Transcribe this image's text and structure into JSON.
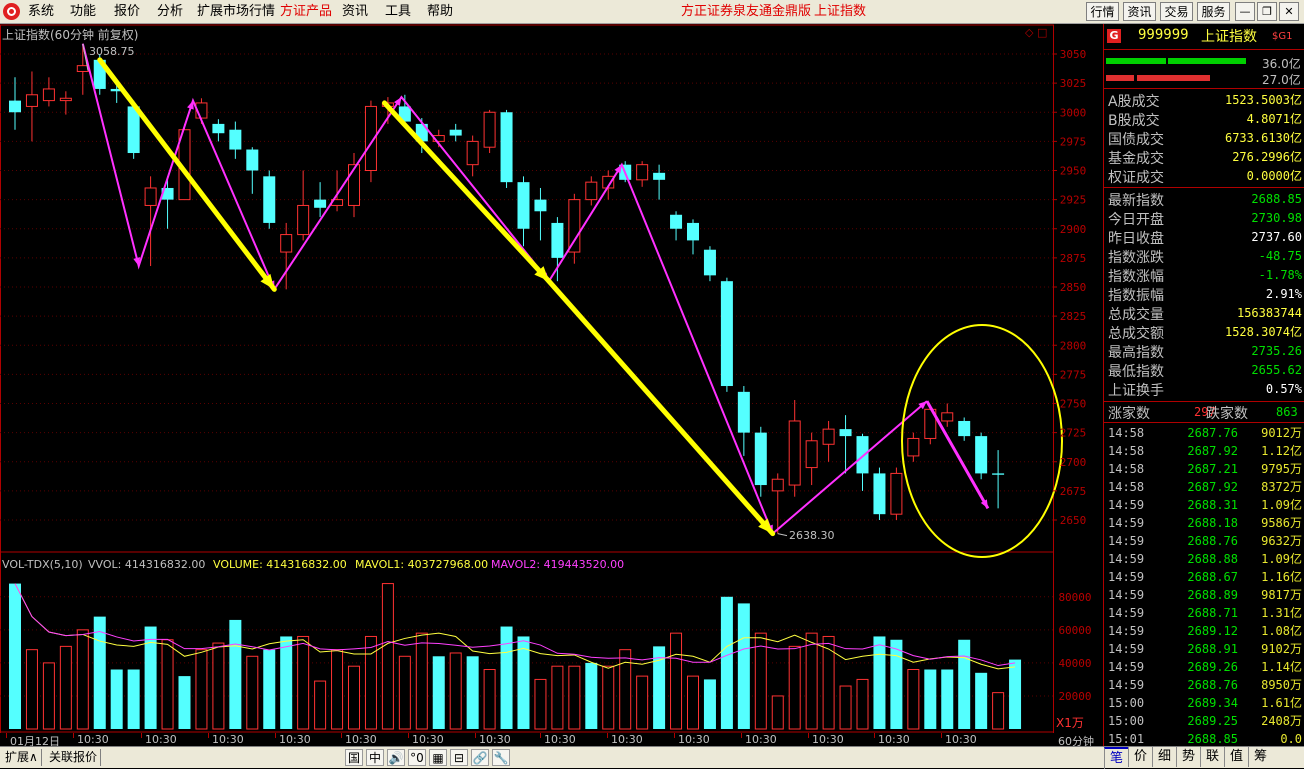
{
  "menubar": {
    "items": [
      "系统",
      "功能",
      "报价",
      "分析",
      "扩展市场行情",
      "方证产品",
      "资讯",
      "工具",
      "帮助"
    ],
    "highlight_item": "方证产品",
    "title": "方正证券泉友通金鼎版",
    "title_index": "上证指数",
    "tab_buttons": [
      "行情",
      "资讯",
      "交易",
      "服务"
    ]
  },
  "chart": {
    "header": "上证指数(60分钟 前复权)",
    "high_marker": "3058.75",
    "low_marker": "2638.30",
    "price_axis": [
      "3050",
      "3025",
      "3000",
      "2975",
      "2950",
      "2925",
      "2900",
      "2875",
      "2850",
      "2825",
      "2800",
      "2775",
      "2750",
      "2725",
      "2700",
      "2675",
      "2650"
    ],
    "vol_header": {
      "name": "VOL-TDX(5,10)",
      "vol": "VVOL: 414316832.00",
      "volume": "VOLUME: 414316832.00",
      "mavol1": "MAVOL1: 403727968.00",
      "mavol2": "MAVOL2: 419443520.00"
    },
    "vol_axis": [
      "80000",
      "60000",
      "40000",
      "20000"
    ],
    "vol_unit": "X1万",
    "time_labels": [
      "01月12日",
      "10:30",
      "10:30",
      "10:30",
      "10:30",
      "10:30",
      "10:30",
      "10:30",
      "10:30",
      "10:30",
      "10:30",
      "10:30",
      "10:30",
      "10:30",
      "10:30",
      "10:30"
    ],
    "period_label": "60分钟",
    "colors": {
      "up": "#ff3232",
      "down": "#54ffff",
      "arrow_big": "#ffff00",
      "arrow_small": "#ff30ff",
      "ma1": "#ffff40",
      "ma2": "#ff40ff",
      "ellipse": "#ffff00"
    }
  },
  "chart_data": {
    "type": "candlestick",
    "title": "上证指数(60分钟 前复权)",
    "period": "60分钟",
    "ylim": [
      2630,
      3070
    ],
    "candles": [
      {
        "o": 3010,
        "c": 3000,
        "h": 3030,
        "l": 2985
      },
      {
        "o": 3005,
        "c": 3015,
        "h": 3035,
        "l": 2975
      },
      {
        "o": 3010,
        "c": 3020,
        "h": 3030,
        "l": 3005
      },
      {
        "o": 3010,
        "c": 3012,
        "h": 3018,
        "l": 2998
      },
      {
        "o": 3035,
        "c": 3040,
        "h": 3058.75,
        "l": 3015
      },
      {
        "o": 3045,
        "c": 3020,
        "h": 3050,
        "l": 3015
      },
      {
        "o": 3020,
        "c": 3018,
        "h": 3025,
        "l": 3008
      },
      {
        "o": 3005,
        "c": 2965,
        "h": 3010,
        "l": 2960
      },
      {
        "o": 2920,
        "c": 2935,
        "h": 2945,
        "l": 2868
      },
      {
        "o": 2935,
        "c": 2925,
        "h": 2945,
        "l": 2900
      },
      {
        "o": 2925,
        "c": 2985,
        "h": 2990,
        "l": 2925
      },
      {
        "o": 2995,
        "c": 3008,
        "h": 3012,
        "l": 2990
      },
      {
        "o": 2990,
        "c": 2982,
        "h": 2994,
        "l": 2975
      },
      {
        "o": 2985,
        "c": 2968,
        "h": 2992,
        "l": 2960
      },
      {
        "o": 2968,
        "c": 2950,
        "h": 2970,
        "l": 2930
      },
      {
        "o": 2945,
        "c": 2905,
        "h": 2950,
        "l": 2900
      },
      {
        "o": 2880,
        "c": 2895,
        "h": 2905,
        "l": 2848
      },
      {
        "o": 2895,
        "c": 2920,
        "h": 2950,
        "l": 2890
      },
      {
        "o": 2925,
        "c": 2918,
        "h": 2940,
        "l": 2910
      },
      {
        "o": 2920,
        "c": 2925,
        "h": 2950,
        "l": 2915
      },
      {
        "o": 2920,
        "c": 2955,
        "h": 2965,
        "l": 2910
      },
      {
        "o": 2950,
        "c": 3005,
        "h": 3010,
        "l": 2940
      },
      {
        "o": 3005,
        "c": 3008,
        "h": 3013,
        "l": 2990
      },
      {
        "o": 3005,
        "c": 2992,
        "h": 3015,
        "l": 2988
      },
      {
        "o": 2990,
        "c": 2975,
        "h": 2995,
        "l": 2965
      },
      {
        "o": 2975,
        "c": 2980,
        "h": 2985,
        "l": 2970
      },
      {
        "o": 2985,
        "c": 2980,
        "h": 2990,
        "l": 2975
      },
      {
        "o": 2955,
        "c": 2975,
        "h": 2980,
        "l": 2945
      },
      {
        "o": 2970,
        "c": 3000,
        "h": 3002,
        "l": 2965
      },
      {
        "o": 3000,
        "c": 2940,
        "h": 3002,
        "l": 2935
      },
      {
        "o": 2940,
        "c": 2900,
        "h": 2945,
        "l": 2885
      },
      {
        "o": 2925,
        "c": 2915,
        "h": 2935,
        "l": 2890
      },
      {
        "o": 2905,
        "c": 2875,
        "h": 2910,
        "l": 2855
      },
      {
        "o": 2880,
        "c": 2925,
        "h": 2930,
        "l": 2870
      },
      {
        "o": 2925,
        "c": 2940,
        "h": 2945,
        "l": 2920
      },
      {
        "o": 2935,
        "c": 2945,
        "h": 2950,
        "l": 2925
      },
      {
        "o": 2955,
        "c": 2942,
        "h": 2958,
        "l": 2940
      },
      {
        "o": 2942,
        "c": 2955,
        "h": 2958,
        "l": 2936
      },
      {
        "o": 2948,
        "c": 2942,
        "h": 2955,
        "l": 2925
      },
      {
        "o": 2912,
        "c": 2900,
        "h": 2915,
        "l": 2890
      },
      {
        "o": 2905,
        "c": 2890,
        "h": 2908,
        "l": 2878
      },
      {
        "o": 2882,
        "c": 2860,
        "h": 2885,
        "l": 2855
      },
      {
        "o": 2855,
        "c": 2765,
        "h": 2858,
        "l": 2760
      },
      {
        "o": 2760,
        "c": 2725,
        "h": 2765,
        "l": 2705
      },
      {
        "o": 2725,
        "c": 2680,
        "h": 2730,
        "l": 2670
      },
      {
        "o": 2675,
        "c": 2685,
        "h": 2690,
        "l": 2638.3
      },
      {
        "o": 2680,
        "c": 2735,
        "h": 2753,
        "l": 2670
      },
      {
        "o": 2695,
        "c": 2718,
        "h": 2725,
        "l": 2680
      },
      {
        "o": 2715,
        "c": 2728,
        "h": 2735,
        "l": 2700
      },
      {
        "o": 2728,
        "c": 2722,
        "h": 2740,
        "l": 2690
      },
      {
        "o": 2722,
        "c": 2690,
        "h": 2724,
        "l": 2675
      },
      {
        "o": 2690,
        "c": 2655,
        "h": 2695,
        "l": 2650
      },
      {
        "o": 2655,
        "c": 2690,
        "h": 2695,
        "l": 2650
      },
      {
        "o": 2705,
        "c": 2720,
        "h": 2725,
        "l": 2700
      },
      {
        "o": 2720,
        "c": 2745,
        "h": 2748,
        "l": 2715
      },
      {
        "o": 2735,
        "c": 2742,
        "h": 2750,
        "l": 2730
      },
      {
        "o": 2735,
        "c": 2722,
        "h": 2738,
        "l": 2718
      },
      {
        "o": 2722,
        "c": 2690,
        "h": 2725,
        "l": 2685
      },
      {
        "o": 2690,
        "c": 2688.85,
        "h": 2710,
        "l": 2660
      }
    ],
    "volume": [
      {
        "v": 88000,
        "up": false
      },
      {
        "v": 48000,
        "up": true
      },
      {
        "v": 40000,
        "up": true
      },
      {
        "v": 50000,
        "up": true
      },
      {
        "v": 60000,
        "up": true
      },
      {
        "v": 68000,
        "up": false
      },
      {
        "v": 36000,
        "up": false
      },
      {
        "v": 36000,
        "up": false
      },
      {
        "v": 62000,
        "up": false
      },
      {
        "v": 54000,
        "up": true
      },
      {
        "v": 32000,
        "up": false
      },
      {
        "v": 48000,
        "up": true
      },
      {
        "v": 52000,
        "up": true
      },
      {
        "v": 66000,
        "up": false
      },
      {
        "v": 44000,
        "up": true
      },
      {
        "v": 48000,
        "up": false
      },
      {
        "v": 56000,
        "up": false
      },
      {
        "v": 56000,
        "up": true
      },
      {
        "v": 29000,
        "up": true
      },
      {
        "v": 48000,
        "up": true
      },
      {
        "v": 38000,
        "up": true
      },
      {
        "v": 56000,
        "up": true
      },
      {
        "v": 88000,
        "up": true
      },
      {
        "v": 44000,
        "up": true
      },
      {
        "v": 58000,
        "up": true
      },
      {
        "v": 44000,
        "up": false
      },
      {
        "v": 46000,
        "up": true
      },
      {
        "v": 44000,
        "up": false
      },
      {
        "v": 36000,
        "up": true
      },
      {
        "v": 62000,
        "up": false
      },
      {
        "v": 56000,
        "up": false
      },
      {
        "v": 30000,
        "up": true
      },
      {
        "v": 38000,
        "up": true
      },
      {
        "v": 38000,
        "up": true
      },
      {
        "v": 40000,
        "up": false
      },
      {
        "v": 38000,
        "up": true
      },
      {
        "v": 48000,
        "up": true
      },
      {
        "v": 32000,
        "up": true
      },
      {
        "v": 50000,
        "up": false
      },
      {
        "v": 58000,
        "up": true
      },
      {
        "v": 32000,
        "up": true
      },
      {
        "v": 30000,
        "up": false
      },
      {
        "v": 80000,
        "up": false
      },
      {
        "v": 76000,
        "up": false
      },
      {
        "v": 58000,
        "up": true
      },
      {
        "v": 20000,
        "up": true
      },
      {
        "v": 50000,
        "up": true
      },
      {
        "v": 58000,
        "up": true
      },
      {
        "v": 56000,
        "up": true
      },
      {
        "v": 26000,
        "up": true
      },
      {
        "v": 30000,
        "up": true
      },
      {
        "v": 56000,
        "up": false
      },
      {
        "v": 54000,
        "up": false
      },
      {
        "v": 36000,
        "up": true
      },
      {
        "v": 36000,
        "up": false
      },
      {
        "v": 36000,
        "up": false
      },
      {
        "v": 54000,
        "up": false
      },
      {
        "v": 34000,
        "up": false
      },
      {
        "v": 22000,
        "up": true
      },
      {
        "v": 42000,
        "up": false
      }
    ],
    "vol_ylim": [
      0,
      95000
    ]
  },
  "quote": {
    "code": "999999",
    "name": "上证指数",
    "tag": "$G1",
    "bar1_value": "36.0亿",
    "bar2_value": "27.0亿",
    "rows_a": [
      {
        "k": "A股成交",
        "v": "1523.5003亿"
      },
      {
        "k": "B股成交",
        "v": "4.8071亿"
      },
      {
        "k": "国债成交",
        "v": "6733.6130亿"
      },
      {
        "k": "基金成交",
        "v": "276.2996亿"
      },
      {
        "k": "权证成交",
        "v": "0.0000亿"
      }
    ],
    "rows_b": [
      {
        "k": "最新指数",
        "v": "2688.85",
        "c": "#00e000"
      },
      {
        "k": "今日开盘",
        "v": "2730.98",
        "c": "#00e000"
      },
      {
        "k": "昨日收盘",
        "v": "2737.60",
        "c": "#ffffff"
      },
      {
        "k": "指数涨跌",
        "v": "-48.75",
        "c": "#00e000"
      },
      {
        "k": "指数涨幅",
        "v": "-1.78%",
        "c": "#00e000"
      },
      {
        "k": "指数振幅",
        "v": "2.91%",
        "c": "#ffffff"
      },
      {
        "k": "总成交量",
        "v": "156383744",
        "c": "#ffff40"
      },
      {
        "k": "总成交额",
        "v": "1528.3074亿",
        "c": "#ffff40"
      },
      {
        "k": "最高指数",
        "v": "2735.26",
        "c": "#00e000"
      },
      {
        "k": "最低指数",
        "v": "2655.62",
        "c": "#00e000"
      },
      {
        "k": "上证换手",
        "v": "0.57%",
        "c": "#ffffff"
      }
    ],
    "up_label": "涨家数",
    "up_count": "297",
    "down_label": "跌家数",
    "down_count": "863",
    "ticks": [
      {
        "t": "14:58",
        "p": "2687.76",
        "v": "9012万"
      },
      {
        "t": "14:58",
        "p": "2687.92",
        "v": "1.12亿"
      },
      {
        "t": "14:58",
        "p": "2687.21",
        "v": "9795万"
      },
      {
        "t": "14:58",
        "p": "2687.92",
        "v": "8372万"
      },
      {
        "t": "14:59",
        "p": "2688.31",
        "v": "1.09亿"
      },
      {
        "t": "14:59",
        "p": "2688.18",
        "v": "9586万"
      },
      {
        "t": "14:59",
        "p": "2688.76",
        "v": "9632万"
      },
      {
        "t": "14:59",
        "p": "2688.88",
        "v": "1.09亿"
      },
      {
        "t": "14:59",
        "p": "2688.67",
        "v": "1.16亿"
      },
      {
        "t": "14:59",
        "p": "2688.89",
        "v": "9817万"
      },
      {
        "t": "14:59",
        "p": "2688.71",
        "v": "1.31亿"
      },
      {
        "t": "14:59",
        "p": "2689.12",
        "v": "1.08亿"
      },
      {
        "t": "14:59",
        "p": "2688.91",
        "v": "9102万"
      },
      {
        "t": "14:59",
        "p": "2689.26",
        "v": "1.14亿"
      },
      {
        "t": "14:59",
        "p": "2688.76",
        "v": "8950万"
      },
      {
        "t": "15:00",
        "p": "2689.34",
        "v": "1.61亿"
      },
      {
        "t": "15:00",
        "p": "2689.25",
        "v": "2408万"
      },
      {
        "t": "15:01",
        "p": "2688.85",
        "v": "0.0"
      }
    ]
  },
  "bottombar": {
    "tabs": [
      "扩展∧",
      "关联报价"
    ],
    "icons": [
      "国",
      "中",
      "🔊",
      "°0",
      "▦",
      "⊟",
      "🔗",
      "🔧"
    ],
    "right_tabs": [
      "笔",
      "价",
      "细",
      "势",
      "联",
      "值",
      "筹"
    ]
  }
}
